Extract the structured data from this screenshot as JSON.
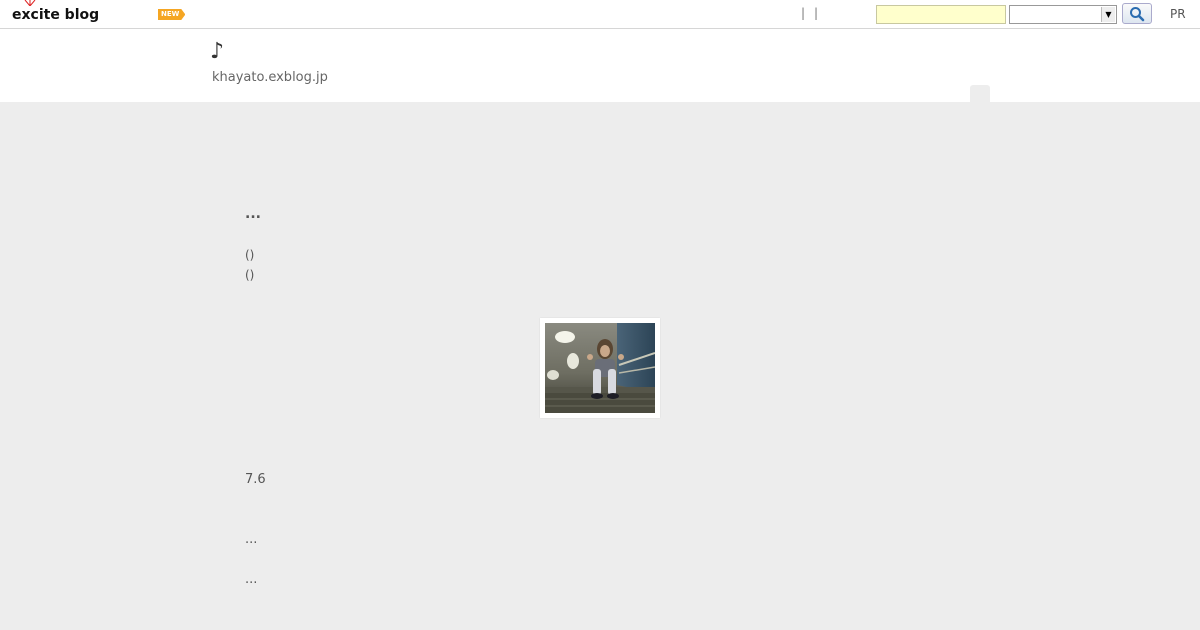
{
  "topbar": {
    "logo_text": "excite blog",
    "new_badge": "NEW",
    "separators": [
      "|",
      "|"
    ],
    "search_value": "",
    "search_select_value": "",
    "pr_label": "PR"
  },
  "header": {
    "title": "♪",
    "url": "khayato.exblog.jp"
  },
  "post": {
    "title": "...",
    "meta_1": "()",
    "meta_2": "()",
    "text_1": "7.6",
    "text_2": "...",
    "text_3": "..."
  },
  "colors": {
    "search_bg": "#ffffcc",
    "badge": "#f5a623",
    "page_bg": "#ededed"
  },
  "icons": {
    "search": "magnifier-icon",
    "dropdown": "triangle-down-icon"
  }
}
